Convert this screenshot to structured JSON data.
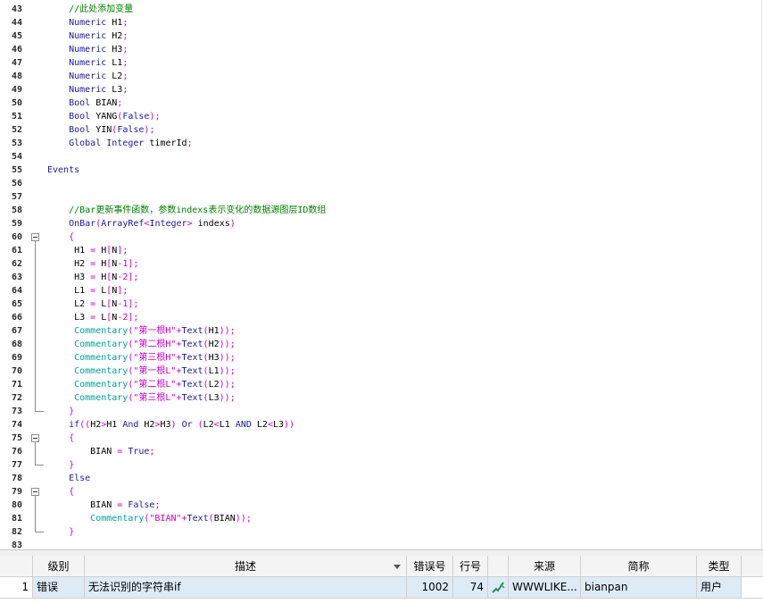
{
  "editor": {
    "lines": [
      {
        "n": "43",
        "tokens": [
          {
            "t": "    ",
            "c": "text"
          },
          {
            "t": "//此处添加变量",
            "c": "comment"
          }
        ]
      },
      {
        "n": "44",
        "tokens": [
          {
            "t": "    ",
            "c": "text"
          },
          {
            "t": "Numeric",
            "c": "type"
          },
          {
            "t": " H1",
            "c": "ident"
          },
          {
            "t": ";",
            "c": "op"
          }
        ]
      },
      {
        "n": "45",
        "tokens": [
          {
            "t": "    ",
            "c": "text"
          },
          {
            "t": "Numeric",
            "c": "type"
          },
          {
            "t": " H2",
            "c": "ident"
          },
          {
            "t": ";",
            "c": "op"
          }
        ]
      },
      {
        "n": "46",
        "tokens": [
          {
            "t": "    ",
            "c": "text"
          },
          {
            "t": "Numeric",
            "c": "type"
          },
          {
            "t": " H3",
            "c": "ident"
          },
          {
            "t": ";",
            "c": "op"
          }
        ]
      },
      {
        "n": "47",
        "tokens": [
          {
            "t": "    ",
            "c": "text"
          },
          {
            "t": "Numeric",
            "c": "type"
          },
          {
            "t": " L1",
            "c": "ident"
          },
          {
            "t": ";",
            "c": "op"
          }
        ]
      },
      {
        "n": "48",
        "tokens": [
          {
            "t": "    ",
            "c": "text"
          },
          {
            "t": "Numeric",
            "c": "type"
          },
          {
            "t": " L2",
            "c": "ident"
          },
          {
            "t": ";",
            "c": "op"
          }
        ]
      },
      {
        "n": "49",
        "tokens": [
          {
            "t": "    ",
            "c": "text"
          },
          {
            "t": "Numeric",
            "c": "type"
          },
          {
            "t": " L3",
            "c": "ident"
          },
          {
            "t": ";",
            "c": "op"
          }
        ]
      },
      {
        "n": "50",
        "tokens": [
          {
            "t": "    ",
            "c": "text"
          },
          {
            "t": "Bool",
            "c": "type"
          },
          {
            "t": " BIAN",
            "c": "ident"
          },
          {
            "t": ";",
            "c": "op"
          }
        ]
      },
      {
        "n": "51",
        "tokens": [
          {
            "t": "    ",
            "c": "text"
          },
          {
            "t": "Bool",
            "c": "type"
          },
          {
            "t": " YANG",
            "c": "ident"
          },
          {
            "t": "(",
            "c": "op"
          },
          {
            "t": "False",
            "c": "bool"
          },
          {
            "t": ");",
            "c": "op"
          }
        ]
      },
      {
        "n": "52",
        "tokens": [
          {
            "t": "    ",
            "c": "text"
          },
          {
            "t": "Bool",
            "c": "type"
          },
          {
            "t": " YIN",
            "c": "ident"
          },
          {
            "t": "(",
            "c": "op"
          },
          {
            "t": "False",
            "c": "bool"
          },
          {
            "t": ");",
            "c": "op"
          }
        ]
      },
      {
        "n": "53",
        "tokens": [
          {
            "t": "    ",
            "c": "text"
          },
          {
            "t": "Global Integer",
            "c": "type"
          },
          {
            "t": " timerId",
            "c": "ident"
          },
          {
            "t": ";",
            "c": "op"
          }
        ]
      },
      {
        "n": "54",
        "tokens": []
      },
      {
        "n": "55",
        "tokens": [
          {
            "t": "Events",
            "c": "type"
          }
        ]
      },
      {
        "n": "56",
        "tokens": []
      },
      {
        "n": "57",
        "tokens": []
      },
      {
        "n": "58",
        "tokens": [
          {
            "t": "    ",
            "c": "text"
          },
          {
            "t": "//Bar更新事件函数，参数indexs表示变化的数据源图层ID数组",
            "c": "comment"
          }
        ]
      },
      {
        "n": "59",
        "tokens": [
          {
            "t": "    ",
            "c": "text"
          },
          {
            "t": "OnBar",
            "c": "type"
          },
          {
            "t": "(",
            "c": "op"
          },
          {
            "t": "ArrayRef",
            "c": "type"
          },
          {
            "t": "<",
            "c": "op"
          },
          {
            "t": "Integer",
            "c": "type"
          },
          {
            "t": ">",
            "c": "op"
          },
          {
            "t": " indexs",
            "c": "ident"
          },
          {
            "t": ")",
            "c": "op"
          }
        ]
      },
      {
        "n": "60",
        "tokens": [
          {
            "t": "    ",
            "c": "text"
          },
          {
            "t": "{",
            "c": "op"
          }
        ]
      },
      {
        "n": "61",
        "tokens": [
          {
            "t": "     H1 ",
            "c": "ident"
          },
          {
            "t": "=",
            "c": "op"
          },
          {
            "t": " H",
            "c": "ident"
          },
          {
            "t": "[",
            "c": "op"
          },
          {
            "t": "N",
            "c": "ident"
          },
          {
            "t": "];",
            "c": "op"
          }
        ]
      },
      {
        "n": "62",
        "tokens": [
          {
            "t": "     H2 ",
            "c": "ident"
          },
          {
            "t": "=",
            "c": "op"
          },
          {
            "t": " H",
            "c": "ident"
          },
          {
            "t": "[",
            "c": "op"
          },
          {
            "t": "N",
            "c": "ident"
          },
          {
            "t": "-1];",
            "c": "op"
          }
        ]
      },
      {
        "n": "63",
        "tokens": [
          {
            "t": "     H3 ",
            "c": "ident"
          },
          {
            "t": "=",
            "c": "op"
          },
          {
            "t": " H",
            "c": "ident"
          },
          {
            "t": "[",
            "c": "op"
          },
          {
            "t": "N",
            "c": "ident"
          },
          {
            "t": "-2];",
            "c": "op"
          }
        ]
      },
      {
        "n": "64",
        "tokens": [
          {
            "t": "     L1 ",
            "c": "ident"
          },
          {
            "t": "=",
            "c": "op"
          },
          {
            "t": " L",
            "c": "ident"
          },
          {
            "t": "[",
            "c": "op"
          },
          {
            "t": "N",
            "c": "ident"
          },
          {
            "t": "];",
            "c": "op"
          }
        ]
      },
      {
        "n": "65",
        "tokens": [
          {
            "t": "     L2 ",
            "c": "ident"
          },
          {
            "t": "=",
            "c": "op"
          },
          {
            "t": " L",
            "c": "ident"
          },
          {
            "t": "[",
            "c": "op"
          },
          {
            "t": "N",
            "c": "ident"
          },
          {
            "t": "-1];",
            "c": "op"
          }
        ]
      },
      {
        "n": "66",
        "tokens": [
          {
            "t": "     L3 ",
            "c": "ident"
          },
          {
            "t": "=",
            "c": "op"
          },
          {
            "t": " L",
            "c": "ident"
          },
          {
            "t": "[",
            "c": "op"
          },
          {
            "t": "N",
            "c": "ident"
          },
          {
            "t": "-2];",
            "c": "op"
          }
        ]
      },
      {
        "n": "67",
        "tokens": [
          {
            "t": "     ",
            "c": "text"
          },
          {
            "t": "Commentary",
            "c": "builtin"
          },
          {
            "t": "(\"第一根H\"+",
            "c": "op"
          },
          {
            "t": "Text",
            "c": "type"
          },
          {
            "t": "(",
            "c": "op"
          },
          {
            "t": "H1",
            "c": "ident"
          },
          {
            "t": "));",
            "c": "op"
          }
        ]
      },
      {
        "n": "68",
        "tokens": [
          {
            "t": "     ",
            "c": "text"
          },
          {
            "t": "Commentary",
            "c": "builtin"
          },
          {
            "t": "(\"第二根H\"+",
            "c": "op"
          },
          {
            "t": "Text",
            "c": "type"
          },
          {
            "t": "(",
            "c": "op"
          },
          {
            "t": "H2",
            "c": "ident"
          },
          {
            "t": "));",
            "c": "op"
          }
        ]
      },
      {
        "n": "69",
        "tokens": [
          {
            "t": "     ",
            "c": "text"
          },
          {
            "t": "Commentary",
            "c": "builtin"
          },
          {
            "t": "(\"第三根H\"+",
            "c": "op"
          },
          {
            "t": "Text",
            "c": "type"
          },
          {
            "t": "(",
            "c": "op"
          },
          {
            "t": "H3",
            "c": "ident"
          },
          {
            "t": "));",
            "c": "op"
          }
        ]
      },
      {
        "n": "70",
        "tokens": [
          {
            "t": "     ",
            "c": "text"
          },
          {
            "t": "Commentary",
            "c": "builtin"
          },
          {
            "t": "(\"第一根L\"+",
            "c": "op"
          },
          {
            "t": "Text",
            "c": "type"
          },
          {
            "t": "(",
            "c": "op"
          },
          {
            "t": "L1",
            "c": "ident"
          },
          {
            "t": "));",
            "c": "op"
          }
        ]
      },
      {
        "n": "71",
        "tokens": [
          {
            "t": "     ",
            "c": "text"
          },
          {
            "t": "Commentary",
            "c": "builtin"
          },
          {
            "t": "(\"第二根L\"+",
            "c": "op"
          },
          {
            "t": "Text",
            "c": "type"
          },
          {
            "t": "(",
            "c": "op"
          },
          {
            "t": "L2",
            "c": "ident"
          },
          {
            "t": "));",
            "c": "op"
          }
        ]
      },
      {
        "n": "72",
        "tokens": [
          {
            "t": "     ",
            "c": "text"
          },
          {
            "t": "Commentary",
            "c": "builtin"
          },
          {
            "t": "(\"第三根L\"+",
            "c": "op"
          },
          {
            "t": "Text",
            "c": "type"
          },
          {
            "t": "(",
            "c": "op"
          },
          {
            "t": "L3",
            "c": "ident"
          },
          {
            "t": "));",
            "c": "op"
          }
        ]
      },
      {
        "n": "73",
        "tokens": [
          {
            "t": "    ",
            "c": "text"
          },
          {
            "t": "}",
            "c": "op"
          }
        ]
      },
      {
        "n": "74",
        "tokens": [
          {
            "t": "    ",
            "c": "text"
          },
          {
            "t": "if",
            "c": "type"
          },
          {
            "t": "((",
            "c": "op"
          },
          {
            "t": "H2",
            "c": "ident"
          },
          {
            "t": ">",
            "c": "op"
          },
          {
            "t": "H1 ",
            "c": "ident"
          },
          {
            "t": "And",
            "c": "type"
          },
          {
            "t": " H2",
            "c": "ident"
          },
          {
            "t": ">",
            "c": "op"
          },
          {
            "t": "H3",
            "c": "ident"
          },
          {
            "t": ") ",
            "c": "op"
          },
          {
            "t": "Or",
            "c": "type"
          },
          {
            "t": " (",
            "c": "op"
          },
          {
            "t": "L2",
            "c": "ident"
          },
          {
            "t": "<",
            "c": "op"
          },
          {
            "t": "L1 ",
            "c": "ident"
          },
          {
            "t": "AND",
            "c": "type"
          },
          {
            "t": " L2",
            "c": "ident"
          },
          {
            "t": "<",
            "c": "op"
          },
          {
            "t": "L3",
            "c": "ident"
          },
          {
            "t": "))",
            "c": "op"
          }
        ]
      },
      {
        "n": "75",
        "tokens": [
          {
            "t": "    ",
            "c": "text"
          },
          {
            "t": "{",
            "c": "op"
          }
        ]
      },
      {
        "n": "76",
        "tokens": [
          {
            "t": "        BIAN ",
            "c": "ident"
          },
          {
            "t": "=",
            "c": "op"
          },
          {
            "t": " True",
            "c": "bool"
          },
          {
            "t": ";",
            "c": "op"
          }
        ]
      },
      {
        "n": "77",
        "tokens": [
          {
            "t": "    ",
            "c": "text"
          },
          {
            "t": "}",
            "c": "op"
          }
        ]
      },
      {
        "n": "78",
        "tokens": [
          {
            "t": "    ",
            "c": "text"
          },
          {
            "t": "Else",
            "c": "type"
          }
        ]
      },
      {
        "n": "79",
        "tokens": [
          {
            "t": "    ",
            "c": "text"
          },
          {
            "t": "{",
            "c": "op"
          }
        ]
      },
      {
        "n": "80",
        "tokens": [
          {
            "t": "        BIAN ",
            "c": "ident"
          },
          {
            "t": "=",
            "c": "op"
          },
          {
            "t": " False",
            "c": "bool"
          },
          {
            "t": ";",
            "c": "op"
          }
        ]
      },
      {
        "n": "81",
        "tokens": [
          {
            "t": "        ",
            "c": "text"
          },
          {
            "t": "Commentary",
            "c": "builtin"
          },
          {
            "t": "(\"BIAN\"+",
            "c": "op"
          },
          {
            "t": "Text",
            "c": "type"
          },
          {
            "t": "(",
            "c": "op"
          },
          {
            "t": "BIAN",
            "c": "ident"
          },
          {
            "t": "));",
            "c": "op"
          }
        ]
      },
      {
        "n": "82",
        "tokens": [
          {
            "t": "    ",
            "c": "text"
          },
          {
            "t": "}",
            "c": "op"
          }
        ]
      },
      {
        "n": "83",
        "tokens": []
      }
    ],
    "fold_markers": [
      "60",
      "75",
      "79"
    ]
  },
  "error_panel": {
    "headers": {
      "level": "级别",
      "description": "描述",
      "error_no": "错误号",
      "line_no": "行号",
      "source": "来源",
      "short_name": "简称",
      "type": "类型"
    },
    "rows": [
      {
        "index": "1",
        "level": "错误",
        "description": "无法识别的字符串if",
        "error_no": "1002",
        "line_no": "74",
        "source_icon": "pencil-check-icon",
        "source": "WWWLIKE...",
        "short_name": "bianpan",
        "type": "用户"
      }
    ]
  },
  "colors": {
    "comment": "#008000",
    "keyword": "#1a1aa6",
    "operator": "#cc00cc",
    "builtin": "#00a0a0",
    "selected_row": "#ddebf7"
  }
}
